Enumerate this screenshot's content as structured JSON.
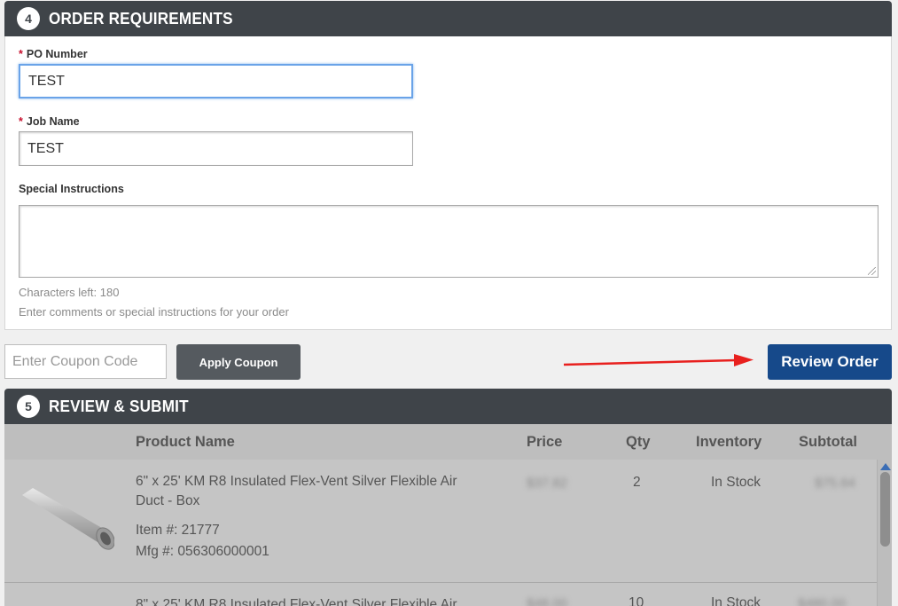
{
  "order_requirements": {
    "step_number": "4",
    "title": "ORDER REQUIREMENTS",
    "required_marker": "*",
    "po_number": {
      "label": "PO Number",
      "value": "TEST"
    },
    "job_name": {
      "label": "Job Name",
      "value": "TEST"
    },
    "special_instructions": {
      "label": "Special Instructions",
      "value": ""
    },
    "characters_left": "Characters left: 180",
    "help_text": "Enter comments or special instructions for your order"
  },
  "coupon": {
    "placeholder": "Enter Coupon Code",
    "apply_label": "Apply Coupon"
  },
  "review_button_label": "Review Order",
  "review_submit": {
    "step_number": "5",
    "title": "REVIEW & SUBMIT",
    "columns": {
      "product_name": "Product Name",
      "price": "Price",
      "qty": "Qty",
      "inventory": "Inventory",
      "subtotal": "Subtotal"
    },
    "items": [
      {
        "name": "6\" x 25' KM R8 Insulated Flex-Vent Silver Flexible Air Duct - Box",
        "item_number": "Item #: 21777",
        "mfg_number": "Mfg #: 056306000001",
        "price": "$37.82",
        "qty": "2",
        "inventory": "In Stock",
        "subtotal": "$75.64"
      },
      {
        "name": "8\" x 25' KM R8 Insulated Flex-Vent Silver Flexible Air",
        "price": "$48.00",
        "qty": "10",
        "inventory": "In Stock",
        "subtotal": "$480.00"
      }
    ]
  },
  "colors": {
    "header_bg": "#3f4449",
    "primary_button": "#16498a",
    "secondary_button": "#555a5f",
    "required_star": "#c8102e",
    "annotation_arrow": "#e8201e"
  }
}
